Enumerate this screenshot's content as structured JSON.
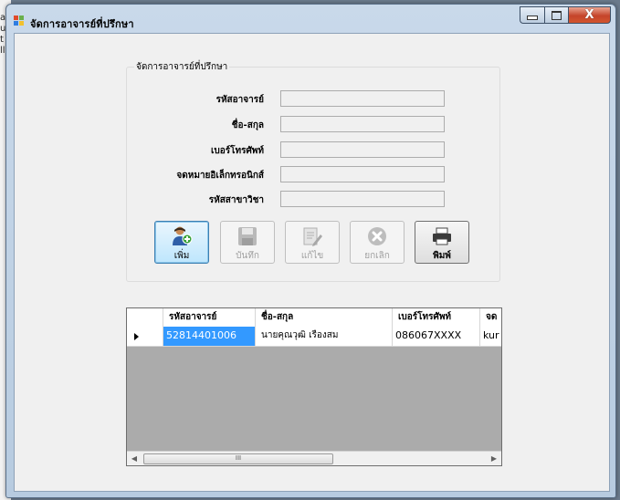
{
  "window": {
    "title": "จัดการอาจารย์ที่ปรึกษา",
    "close_glyph": "X"
  },
  "background_left_text": [
    "a",
    "u",
    "t",
    "ll"
  ],
  "group": {
    "title": "จัดการอาจารย์ที่ปรึกษา",
    "fields": [
      {
        "label": "รหัสอาจารย์",
        "value": ""
      },
      {
        "label": "ชื่อ-สกุล",
        "value": ""
      },
      {
        "label": "เบอร์โทรศัพท์",
        "value": ""
      },
      {
        "label": "จดหมายอิเล็กทรอนิกส์",
        "value": ""
      },
      {
        "label": "รหัสสาขาวิชา",
        "value": ""
      }
    ]
  },
  "buttons": {
    "add": "เพิ่ม",
    "save": "บันทึก",
    "edit": "แก้ไข",
    "cancel": "ยกเลิก",
    "print": "พิมพ์"
  },
  "grid": {
    "columns": [
      "รหัสอาจารย์",
      "ชื่อ-สกุล",
      "เบอร์โทรศัพท์",
      "จด"
    ],
    "rows": [
      [
        "52814401006",
        "นายคุณวุฒิ เรืองสม",
        "086067XXXX",
        "kur"
      ]
    ],
    "scroll_thumb_glyph": "III"
  },
  "colors": {
    "selection": "#3399ff",
    "close_button": "#c5442a",
    "grid_background": "#ababab"
  }
}
